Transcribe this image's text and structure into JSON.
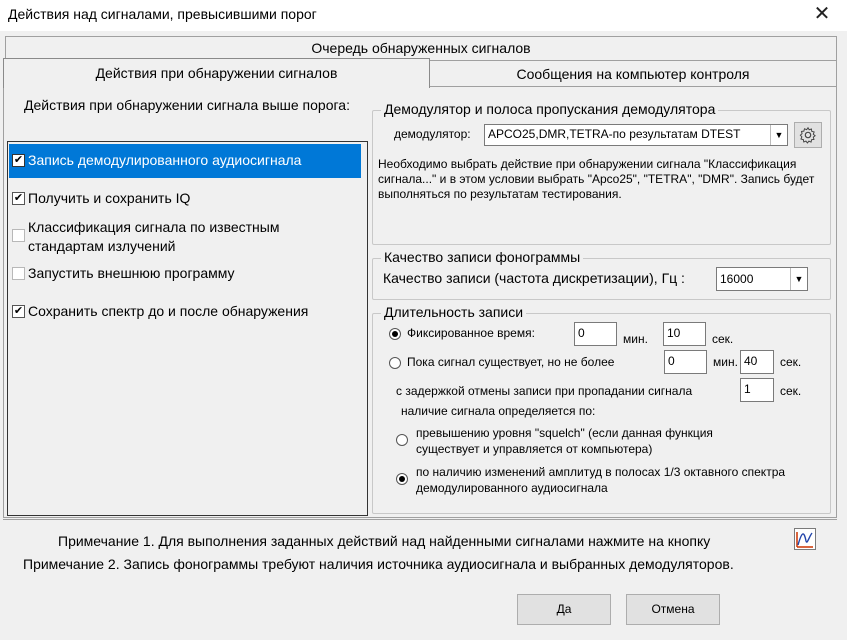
{
  "window": {
    "title": "Действия над сигналами, превысившими порог",
    "close_symbol": "✕"
  },
  "tabs": {
    "back": "Очередь обнаруженных сигналов",
    "active": "Действия при обнаружении сигналов",
    "right": "Сообщения на компьютер контроля"
  },
  "left": {
    "header": "Действия при обнаружении сигнала выше порога:",
    "items": [
      {
        "label": "Запись демодулированного аудиосигнала",
        "checked": true,
        "selected": true
      },
      {
        "label": "Получить и сохранить IQ",
        "checked": true
      },
      {
        "label": "Классификация сигнала по известным стандартам излучений",
        "checked": false
      },
      {
        "label": "Запустить внешнюю программу",
        "checked": false
      },
      {
        "label": "Сохранить спектр до и после обнаружения",
        "checked": true
      }
    ],
    "check_mark": "✔"
  },
  "demod": {
    "legend": "Демодулятор и полоса пропускания демодулятора",
    "label": "демодулятор:",
    "value": "APCO25,DMR,TETRA-по результатам DTEST",
    "note": "Необходимо выбрать действие при обнаружении сигнала \"Классификация сигнала...\" и в этом условии выбрать \"Apco25\", \"TETRA\", \"DMR\". Запись будет выполняться по результатам тестирования."
  },
  "quality": {
    "legend": "Качество записи фонограммы",
    "label": "Качество записи (частота дискретизации), Гц :",
    "value": "16000"
  },
  "duration": {
    "legend": "Длительность записи",
    "fixed_label": "Фиксированное время:",
    "fixed_min": "0",
    "min_unit": "мин.",
    "fixed_sec": "10",
    "sec_unit": "сек.",
    "while_label": "Пока сигнал существует, но не более",
    "while_min": "0",
    "while_sec": "40",
    "delay_label": "с задержкой отмены записи при пропадании сигнала",
    "delay_sec": "1",
    "presence_label": "наличие сигнала определяется по:",
    "squelch_label": "превышению уровня \"squelch\" (если данная функция существует и управляется от компьютера)",
    "ampl_label": "по наличию изменений амплитуд в полосах 1/3 октавного спектра демодулированного аудиосигнала"
  },
  "notes": {
    "note1": "Примечание 1. Для выполнения заданных действий  над найденными сигналами нажмите на кнопку",
    "note2": "Примечание 2. Запись фонограммы требуют наличия источника аудиосигнала и выбранных демодуляторов."
  },
  "buttons": {
    "ok": "Да",
    "cancel": "Отмена"
  },
  "icons": {
    "gear": "gear-icon",
    "arrow": "▼",
    "action": "chart-action-icon"
  },
  "colors": {
    "selection": "#0078d7",
    "face": "#f0f0f0"
  }
}
